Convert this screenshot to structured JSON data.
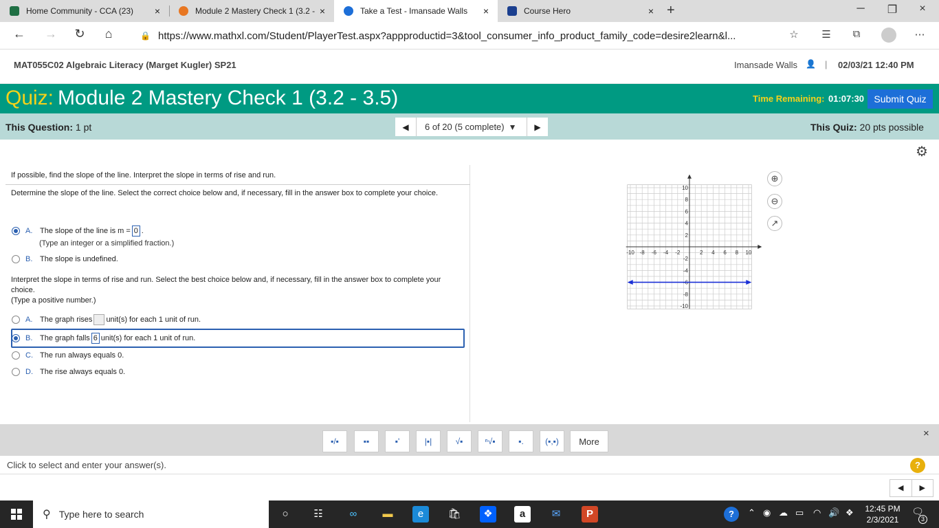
{
  "browser": {
    "tabs": [
      {
        "title": "Home Community - CCA (23)",
        "color": "#1f6f43"
      },
      {
        "title": "Module 2 Mastery Check 1 (3.2 - ",
        "color": "#e87722"
      },
      {
        "title": "Take a Test - Imansade Walls",
        "color": "#1d6fd8"
      },
      {
        "title": "Course Hero",
        "color": "#1b3f8f"
      }
    ],
    "close_glyph": "×",
    "new_tab_glyph": "+",
    "url": "https://www.mathxl.com/Student/PlayerTest.aspx?appproductid=3&tool_consumer_info_product_family_code=desire2learn&l..."
  },
  "course": {
    "title": "MAT055C02 Algebraic Literacy (Marget Kugler) SP21",
    "user": "Imansade Walls",
    "separator": "|",
    "datetime": "02/03/21 12:40 PM"
  },
  "quiz": {
    "label": "Quiz:",
    "name": "Module 2 Mastery Check 1 (3.2 - 3.5)",
    "time_label": "Time Remaining:",
    "time_value": "01:07:30",
    "submit_label": "Submit Quiz"
  },
  "question_bar": {
    "this_question_label": "This Question:",
    "this_question_value": "1 pt",
    "position": "6 of 20 (5 complete)",
    "this_quiz_label": "This Quiz:",
    "this_quiz_value": "20 pts possible"
  },
  "question": {
    "intro": "If possible, find the slope of the line. Interpret the slope in terms of rise and run.",
    "part1_prompt": "Determine the slope of the line. Select the correct choice below and, if necessary, fill in the answer box to complete your choice.",
    "part1_options": [
      {
        "letter": "A.",
        "pre": "The slope of the line is m =",
        "answer": "0",
        "post": ".",
        "hint": "(Type an integer or a simplified fraction.)",
        "selected": true
      },
      {
        "letter": "B.",
        "text": "The slope is undefined.",
        "selected": false
      }
    ],
    "part2_prompt": "Interpret the slope in terms of rise and run. Select the best choice below and, if necessary, fill in the answer box to complete your choice.",
    "part2_hint": "(Type a positive number.)",
    "part2_options": [
      {
        "letter": "A.",
        "pre": "The graph rises",
        "answer": "",
        "post": "unit(s) for each 1 unit of run.",
        "selected": false
      },
      {
        "letter": "B.",
        "pre": "The graph falls",
        "answer": "6",
        "post": "unit(s) for each 1 unit of run.",
        "selected": true
      },
      {
        "letter": "C.",
        "text": "The run always equals 0.",
        "selected": false
      },
      {
        "letter": "D.",
        "text": "The rise always equals 0.",
        "selected": false
      }
    ]
  },
  "graph": {
    "x_ticks": [
      "-10",
      "-8",
      "-6",
      "-4",
      "-2",
      "2",
      "4",
      "6",
      "8",
      "10"
    ],
    "y_ticks": [
      "10",
      "8",
      "6",
      "4",
      "2",
      "-2",
      "-4",
      "-6",
      "-8",
      "-10"
    ],
    "line_y": -6,
    "line_color": "#1a2fd6"
  },
  "toolbar": {
    "more_label": "More",
    "close_glyph": "×"
  },
  "status": {
    "text": "Click to select and enter your answer(s).",
    "help": "?"
  },
  "taskbar": {
    "search_placeholder": "Type here to search",
    "time": "12:45 PM",
    "date": "2/3/2021",
    "notification_count": "3"
  }
}
